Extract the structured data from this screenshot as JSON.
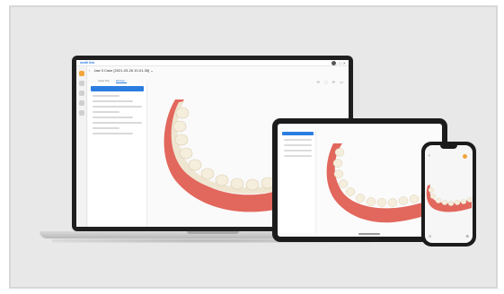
{
  "laptop": {
    "brand": "medit link",
    "window_controls": "— ☐ ✕",
    "case_title": "Jaw 3 Case [2021-03-26 10-01-36] ⌄",
    "back_icon": "‹",
    "tabs": [
      "",
      "Case Info",
      "Worksp..."
    ],
    "panel_button": "",
    "rail_icons": [
      "home-icon",
      "case-icon",
      "scan-icon",
      "cad-icon",
      "settings-icon"
    ],
    "tools": "⟲ ⬚ ⟳ ▭"
  },
  "tablet": {},
  "phone": {
    "back_icon": "‹",
    "bottom_left": "⊙",
    "bottom_right": "⚙"
  },
  "colors": {
    "accent": "#2b7de0",
    "orange": "#f3a43a",
    "gum": "#e2675c",
    "tooth": "#efe6d2",
    "frame": "#e8e8e8"
  }
}
